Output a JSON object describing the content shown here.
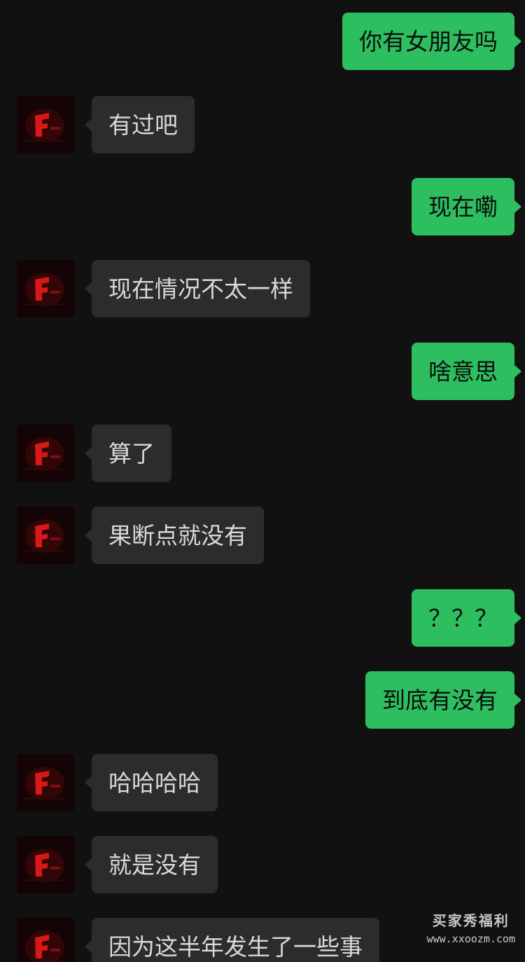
{
  "messages": [
    {
      "side": "out",
      "text": "你有女朋友吗"
    },
    {
      "side": "in",
      "text": "有过吧"
    },
    {
      "side": "out",
      "text": "现在嘞"
    },
    {
      "side": "in",
      "text": "现在情况不太一样"
    },
    {
      "side": "out",
      "text": "啥意思"
    },
    {
      "side": "in",
      "text": "算了"
    },
    {
      "side": "in",
      "text": "果断点就没有"
    },
    {
      "side": "out",
      "text": "？？？"
    },
    {
      "side": "out",
      "text": "到底有没有"
    },
    {
      "side": "in",
      "text": "哈哈哈哈"
    },
    {
      "side": "in",
      "text": "就是没有"
    },
    {
      "side": "in",
      "text": "因为这半年发生了一些事"
    }
  ],
  "watermark": {
    "title": "买家秀福利",
    "url": "www.xxoozm.com"
  },
  "colors": {
    "background": "#111111",
    "incoming_bubble": "#2c2c2c",
    "outgoing_bubble": "#2dbe60"
  },
  "icons": {
    "avatar": "red-logo-avatar-icon"
  }
}
